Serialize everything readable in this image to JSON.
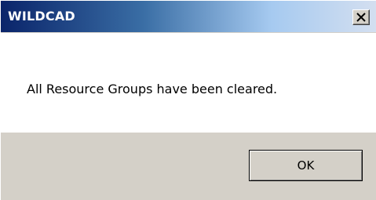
{
  "window": {
    "title": "WILDCAD",
    "close_glyph": "X"
  },
  "message": {
    "text": "All Resource Groups have been cleared."
  },
  "buttons": {
    "ok_label": "OK"
  },
  "icons": {
    "close": "close-icon"
  },
  "colors": {
    "title_start": "#0a246a",
    "title_end": "#d4dff0",
    "footer_bg": "#d4d0c8"
  }
}
